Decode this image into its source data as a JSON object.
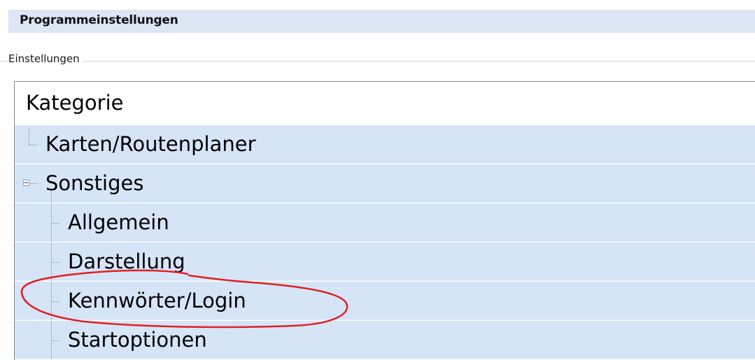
{
  "window": {
    "title": "Programmeinstellungen"
  },
  "group": {
    "label": "Einstellungen"
  },
  "tree": {
    "header": "Kategorie",
    "items": [
      {
        "label": "Karten/Routenplaner",
        "level": 0,
        "expandable": false
      },
      {
        "label": "Sonstiges",
        "level": 0,
        "expandable": true,
        "expanded": true
      },
      {
        "label": "Allgemein",
        "level": 1,
        "expandable": false
      },
      {
        "label": "Darstellung",
        "level": 1,
        "expandable": false
      },
      {
        "label": "Kennwörter/Login",
        "level": 1,
        "expandable": false,
        "annotated": true
      },
      {
        "label": "Startoptionen",
        "level": 1,
        "expandable": false
      }
    ]
  },
  "colors": {
    "row_background": "#d6e4f8",
    "title_background": "#dce6f4",
    "annotation_stroke": "#e02020"
  },
  "icons": {
    "expander": "collapse-minus-icon",
    "tree_lines": "dotted-tree-connector"
  }
}
